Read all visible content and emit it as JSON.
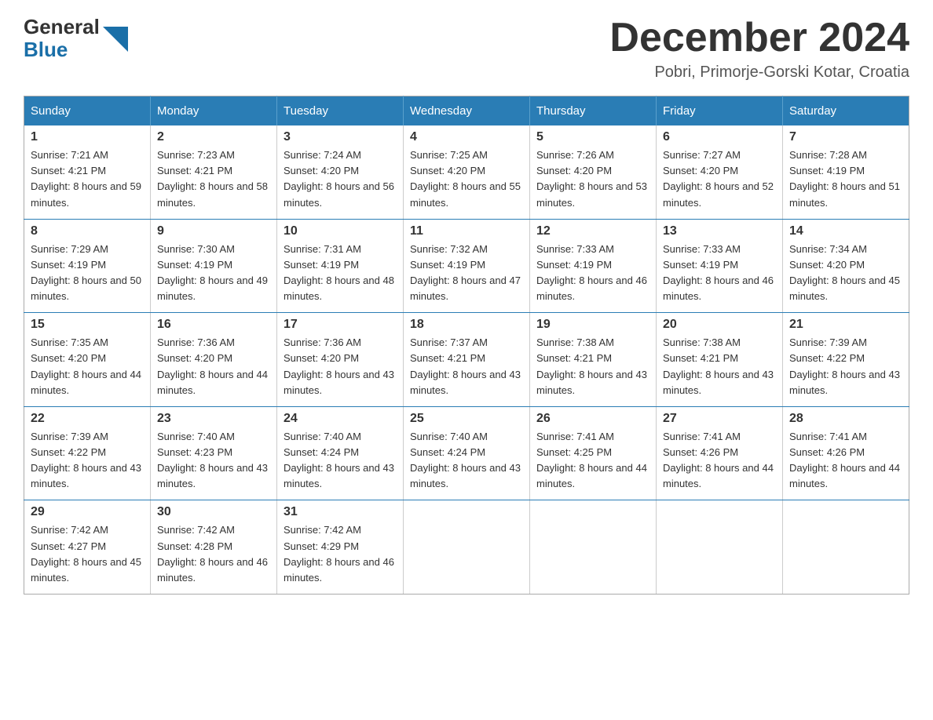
{
  "logo": {
    "general": "General",
    "blue": "Blue"
  },
  "header": {
    "month": "December 2024",
    "location": "Pobri, Primorje-Gorski Kotar, Croatia"
  },
  "days_of_week": [
    "Sunday",
    "Monday",
    "Tuesday",
    "Wednesday",
    "Thursday",
    "Friday",
    "Saturday"
  ],
  "weeks": [
    [
      {
        "day": "1",
        "sunrise": "7:21 AM",
        "sunset": "4:21 PM",
        "daylight": "8 hours and 59 minutes."
      },
      {
        "day": "2",
        "sunrise": "7:23 AM",
        "sunset": "4:21 PM",
        "daylight": "8 hours and 58 minutes."
      },
      {
        "day": "3",
        "sunrise": "7:24 AM",
        "sunset": "4:20 PM",
        "daylight": "8 hours and 56 minutes."
      },
      {
        "day": "4",
        "sunrise": "7:25 AM",
        "sunset": "4:20 PM",
        "daylight": "8 hours and 55 minutes."
      },
      {
        "day": "5",
        "sunrise": "7:26 AM",
        "sunset": "4:20 PM",
        "daylight": "8 hours and 53 minutes."
      },
      {
        "day": "6",
        "sunrise": "7:27 AM",
        "sunset": "4:20 PM",
        "daylight": "8 hours and 52 minutes."
      },
      {
        "day": "7",
        "sunrise": "7:28 AM",
        "sunset": "4:19 PM",
        "daylight": "8 hours and 51 minutes."
      }
    ],
    [
      {
        "day": "8",
        "sunrise": "7:29 AM",
        "sunset": "4:19 PM",
        "daylight": "8 hours and 50 minutes."
      },
      {
        "day": "9",
        "sunrise": "7:30 AM",
        "sunset": "4:19 PM",
        "daylight": "8 hours and 49 minutes."
      },
      {
        "day": "10",
        "sunrise": "7:31 AM",
        "sunset": "4:19 PM",
        "daylight": "8 hours and 48 minutes."
      },
      {
        "day": "11",
        "sunrise": "7:32 AM",
        "sunset": "4:19 PM",
        "daylight": "8 hours and 47 minutes."
      },
      {
        "day": "12",
        "sunrise": "7:33 AM",
        "sunset": "4:19 PM",
        "daylight": "8 hours and 46 minutes."
      },
      {
        "day": "13",
        "sunrise": "7:33 AM",
        "sunset": "4:19 PM",
        "daylight": "8 hours and 46 minutes."
      },
      {
        "day": "14",
        "sunrise": "7:34 AM",
        "sunset": "4:20 PM",
        "daylight": "8 hours and 45 minutes."
      }
    ],
    [
      {
        "day": "15",
        "sunrise": "7:35 AM",
        "sunset": "4:20 PM",
        "daylight": "8 hours and 44 minutes."
      },
      {
        "day": "16",
        "sunrise": "7:36 AM",
        "sunset": "4:20 PM",
        "daylight": "8 hours and 44 minutes."
      },
      {
        "day": "17",
        "sunrise": "7:36 AM",
        "sunset": "4:20 PM",
        "daylight": "8 hours and 43 minutes."
      },
      {
        "day": "18",
        "sunrise": "7:37 AM",
        "sunset": "4:21 PM",
        "daylight": "8 hours and 43 minutes."
      },
      {
        "day": "19",
        "sunrise": "7:38 AM",
        "sunset": "4:21 PM",
        "daylight": "8 hours and 43 minutes."
      },
      {
        "day": "20",
        "sunrise": "7:38 AM",
        "sunset": "4:21 PM",
        "daylight": "8 hours and 43 minutes."
      },
      {
        "day": "21",
        "sunrise": "7:39 AM",
        "sunset": "4:22 PM",
        "daylight": "8 hours and 43 minutes."
      }
    ],
    [
      {
        "day": "22",
        "sunrise": "7:39 AM",
        "sunset": "4:22 PM",
        "daylight": "8 hours and 43 minutes."
      },
      {
        "day": "23",
        "sunrise": "7:40 AM",
        "sunset": "4:23 PM",
        "daylight": "8 hours and 43 minutes."
      },
      {
        "day": "24",
        "sunrise": "7:40 AM",
        "sunset": "4:24 PM",
        "daylight": "8 hours and 43 minutes."
      },
      {
        "day": "25",
        "sunrise": "7:40 AM",
        "sunset": "4:24 PM",
        "daylight": "8 hours and 43 minutes."
      },
      {
        "day": "26",
        "sunrise": "7:41 AM",
        "sunset": "4:25 PM",
        "daylight": "8 hours and 44 minutes."
      },
      {
        "day": "27",
        "sunrise": "7:41 AM",
        "sunset": "4:26 PM",
        "daylight": "8 hours and 44 minutes."
      },
      {
        "day": "28",
        "sunrise": "7:41 AM",
        "sunset": "4:26 PM",
        "daylight": "8 hours and 44 minutes."
      }
    ],
    [
      {
        "day": "29",
        "sunrise": "7:42 AM",
        "sunset": "4:27 PM",
        "daylight": "8 hours and 45 minutes."
      },
      {
        "day": "30",
        "sunrise": "7:42 AM",
        "sunset": "4:28 PM",
        "daylight": "8 hours and 46 minutes."
      },
      {
        "day": "31",
        "sunrise": "7:42 AM",
        "sunset": "4:29 PM",
        "daylight": "8 hours and 46 minutes."
      },
      null,
      null,
      null,
      null
    ]
  ]
}
